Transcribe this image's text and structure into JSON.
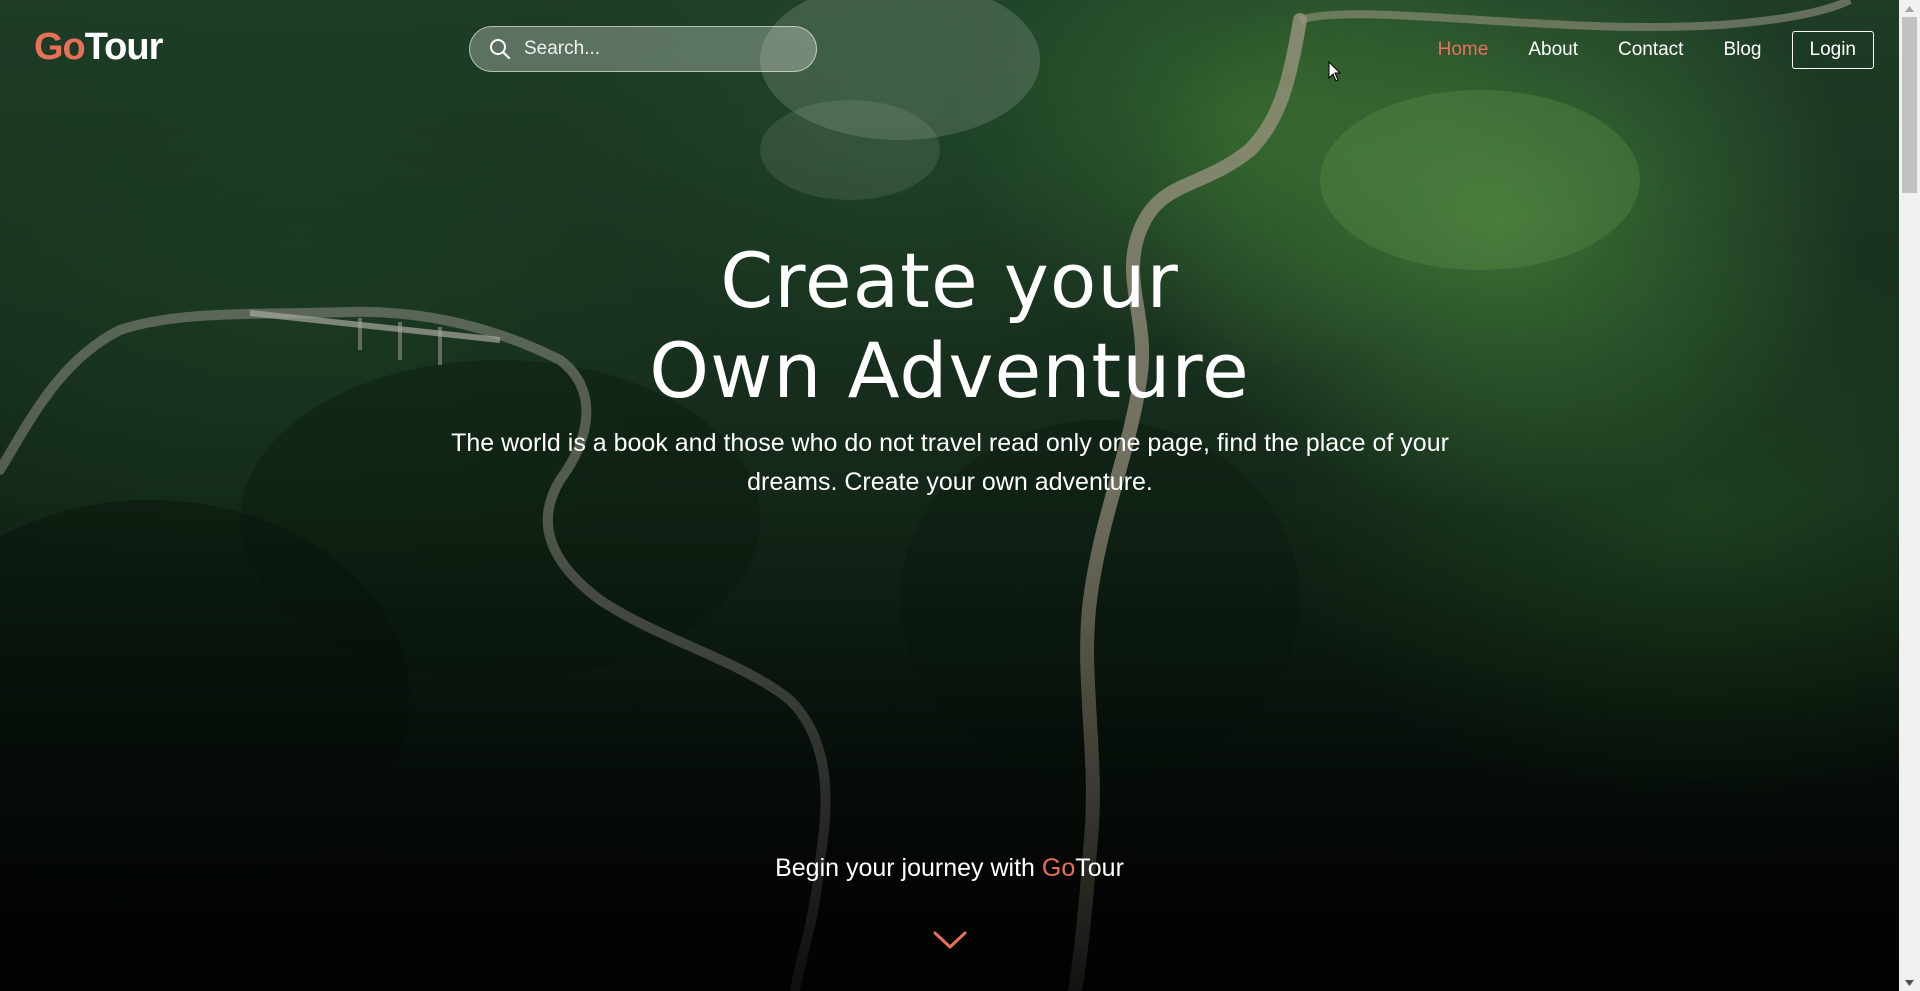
{
  "header": {
    "logo": {
      "prefix": "Go",
      "suffix": "Tour"
    },
    "search": {
      "placeholder": "Search..."
    },
    "nav": {
      "home": "Home",
      "about": "About",
      "contact": "Contact",
      "blog": "Blog",
      "login": "Login"
    }
  },
  "hero": {
    "title_line1": "Create your",
    "title_line2": "Own Adventure",
    "tagline": "The world is a book and those who do not travel read only one page, find the place of your dreams. Create your own adventure.",
    "journey_prefix": "Begin your journey with ",
    "journey_brand_prefix": "Go",
    "journey_brand_suffix": "Tour"
  },
  "colors": {
    "accent": "#e8705a",
    "text": "#ffffff"
  },
  "icons": {
    "search": "search-icon",
    "scroll_down": "chevron-down-icon"
  }
}
